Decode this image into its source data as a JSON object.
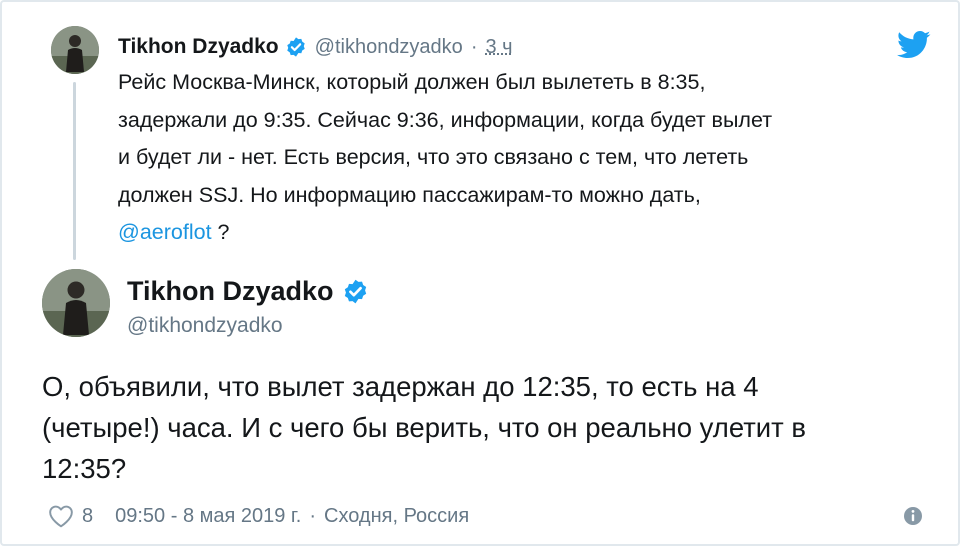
{
  "parent_tweet": {
    "author_name": "Tikhon Dzyadko",
    "handle": "@tikhondzyadko",
    "separator": "·",
    "time": "3 ч",
    "text_lines": [
      "Рейс Москва-Минск, который должен был вылететь в 8:35,",
      "задержали до 9:35. Сейчас 9:36, информации, когда будет вылет",
      "и будет ли - нет. Есть версия, что это связано с тем, что лететь",
      "должен SSJ. Но информацию пассажирам-то можно дать,"
    ],
    "mention": "@aeroflot",
    "after_mention": " ?"
  },
  "main_tweet": {
    "author_name": "Tikhon Dzyadko",
    "handle": "@tikhondzyadko",
    "text_lines": [
      "О, объявили, что вылет задержан до 12:35, то есть на 4",
      "(четыре!) часа. И с чего бы верить, что он реально улетит в",
      "12:35?"
    ],
    "likes": "8",
    "timestamp": "09:50 - 8 мая 2019 г.",
    "separator": "·",
    "location": "Сходня, Россия"
  },
  "icons": {
    "verified": "verified-badge-icon",
    "bird": "twitter-bird-icon",
    "heart": "heart-icon",
    "info": "info-icon"
  },
  "colors": {
    "twitter_blue": "#1da1f2",
    "mention_blue": "#1b95e0",
    "secondary_text": "#657786",
    "primary_text": "#14171a"
  }
}
